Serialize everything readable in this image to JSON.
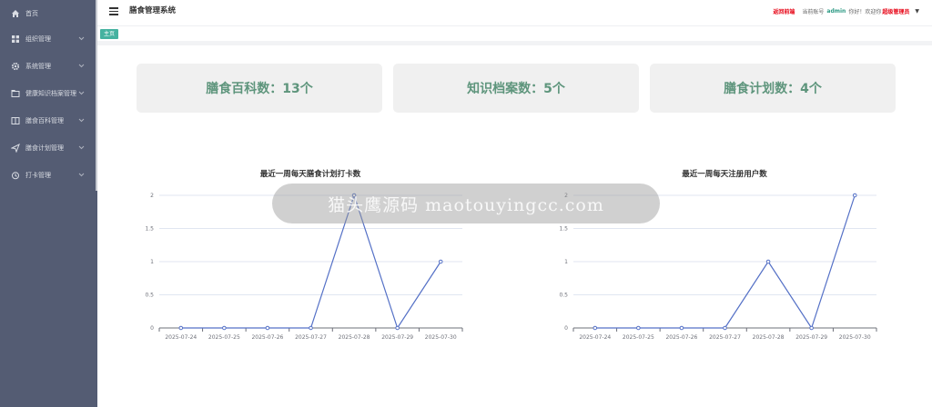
{
  "sidebar": {
    "items": [
      {
        "label": "首页",
        "icon": "home-icon"
      },
      {
        "label": "组织管理",
        "icon": "grid-icon"
      },
      {
        "label": "系统管理",
        "icon": "gear-icon"
      },
      {
        "label": "健康知识档案管理",
        "icon": "folder-icon"
      },
      {
        "label": "膳食百科管理",
        "icon": "book-icon"
      },
      {
        "label": "膳食计划管理",
        "icon": "send-icon"
      },
      {
        "label": "打卡管理",
        "icon": "clock-icon"
      }
    ]
  },
  "header": {
    "title": "膳食管理系统",
    "back_link": "返回前端",
    "account_prefix": "当前账号",
    "account_name": "admin",
    "greeting": "你好！欢迎你",
    "role_link": "超级管理员"
  },
  "tabs": {
    "home": "主页"
  },
  "stats": [
    {
      "label": "膳食百科数：13个"
    },
    {
      "label": "知识档案数：5个"
    },
    {
      "label": "膳食计划数：4个"
    }
  ],
  "watermark": "猫头鹰源码 maotouyingcc.com",
  "colors": {
    "sidebar": "#545c73",
    "accent": "#45b2a0",
    "line": "#5470c6",
    "stat_text": "#5e957c",
    "red": "#e60012"
  },
  "chart_data": [
    {
      "type": "line",
      "title": "最近一周每天膳食计划打卡数",
      "categories": [
        "2025-07-24",
        "2025-07-25",
        "2025-07-26",
        "2025-07-27",
        "2025-07-28",
        "2025-07-29",
        "2025-07-30"
      ],
      "values": [
        0,
        0,
        0,
        0,
        2,
        0,
        1
      ],
      "yticks": [
        "0",
        "0.5",
        "1",
        "1.5",
        "2"
      ],
      "ylim": [
        0,
        2
      ],
      "grid": true
    },
    {
      "type": "line",
      "title": "最近一周每天注册用户数",
      "categories": [
        "2025-07-24",
        "2025-07-25",
        "2025-07-26",
        "2025-07-27",
        "2025-07-28",
        "2025-07-29",
        "2025-07-30"
      ],
      "values": [
        0,
        0,
        0,
        0,
        1,
        0,
        2
      ],
      "yticks": [
        "0",
        "0.5",
        "1",
        "1.5",
        "2"
      ],
      "ylim": [
        0,
        2
      ],
      "grid": true
    }
  ]
}
